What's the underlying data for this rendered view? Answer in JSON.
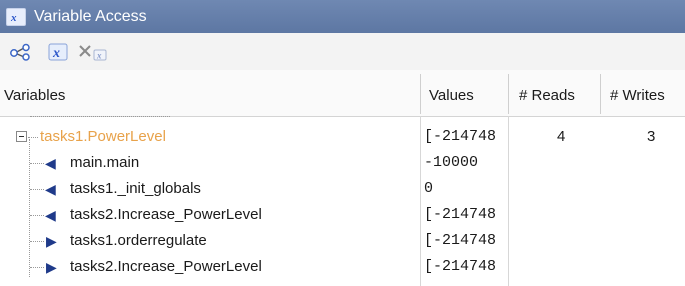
{
  "window": {
    "title": "Variable Access",
    "title_icon": "variable-x-icon"
  },
  "toolbar": {
    "buttons": [
      {
        "icon": "network-graph-icon"
      },
      {
        "icon": "variable-x-icon"
      },
      {
        "icon": "delete-variable-icon"
      }
    ]
  },
  "table": {
    "columns": [
      "Variables",
      "Values",
      "# Reads",
      "# Writes"
    ],
    "parent": {
      "name": "tasks1.PowerLevel",
      "value": "[-214748",
      "reads": "4",
      "writes": "3"
    },
    "children": [
      {
        "direction": "left",
        "name": "main.main",
        "value": "-10000"
      },
      {
        "direction": "left",
        "name": "tasks1._init_globals",
        "value": "0"
      },
      {
        "direction": "left",
        "name": "tasks2.Increase_PowerLevel",
        "value": "[-214748"
      },
      {
        "direction": "right",
        "name": "tasks1.orderregulate",
        "value": "[-214748"
      },
      {
        "direction": "right",
        "name": "tasks2.Increase_PowerLevel",
        "value": "[-214748"
      }
    ]
  },
  "colors": {
    "titlebar": "#6f88b2",
    "parent_variable": "#e8a24a",
    "arrow": "#1f3a8a"
  }
}
